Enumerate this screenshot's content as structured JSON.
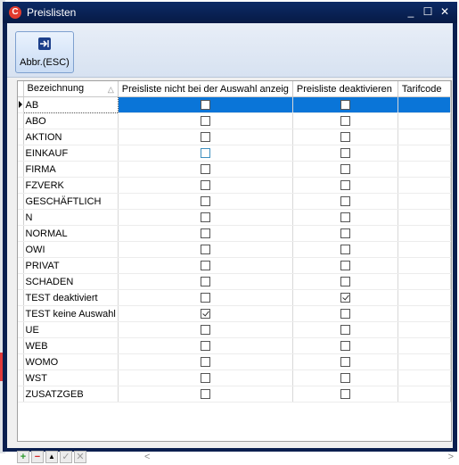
{
  "window": {
    "title": "Preislisten",
    "logo_letter": "C"
  },
  "window_buttons": {
    "minimize": "_",
    "maximize": "☐",
    "close": "✕"
  },
  "toolbar": {
    "close_label": "Abbr.(ESC)",
    "close_icon": "exit-arrow-icon"
  },
  "grid": {
    "columns": [
      "Bezeichnung",
      "Preisliste nicht bei der Auswahl anzeig",
      "Preisliste deaktivieren",
      "Tarifcode"
    ],
    "sort_indicator": "△",
    "selected_row": 0,
    "rows": [
      {
        "name": "AB",
        "hide": false,
        "deactivate": false,
        "tarif": ""
      },
      {
        "name": "ABO",
        "hide": false,
        "deactivate": false,
        "tarif": ""
      },
      {
        "name": "AKTION",
        "hide": false,
        "deactivate": false,
        "tarif": ""
      },
      {
        "name": "EINKAUF",
        "hide": false,
        "deactivate": false,
        "tarif": ""
      },
      {
        "name": "FIRMA",
        "hide": false,
        "deactivate": false,
        "tarif": ""
      },
      {
        "name": "FZVERK",
        "hide": false,
        "deactivate": false,
        "tarif": ""
      },
      {
        "name": "GESCHÄFTLICH",
        "hide": false,
        "deactivate": false,
        "tarif": ""
      },
      {
        "name": "N",
        "hide": false,
        "deactivate": false,
        "tarif": ""
      },
      {
        "name": "NORMAL",
        "hide": false,
        "deactivate": false,
        "tarif": ""
      },
      {
        "name": "OWI",
        "hide": false,
        "deactivate": false,
        "tarif": ""
      },
      {
        "name": "PRIVAT",
        "hide": false,
        "deactivate": false,
        "tarif": ""
      },
      {
        "name": "SCHADEN",
        "hide": false,
        "deactivate": false,
        "tarif": ""
      },
      {
        "name": "TEST deaktiviert",
        "hide": false,
        "deactivate": true,
        "tarif": ""
      },
      {
        "name": "TEST keine Auswahl",
        "hide": true,
        "deactivate": false,
        "tarif": ""
      },
      {
        "name": "UE",
        "hide": false,
        "deactivate": false,
        "tarif": ""
      },
      {
        "name": "WEB",
        "hide": false,
        "deactivate": false,
        "tarif": ""
      },
      {
        "name": "WOMO",
        "hide": false,
        "deactivate": false,
        "tarif": ""
      },
      {
        "name": "WST",
        "hide": false,
        "deactivate": false,
        "tarif": ""
      },
      {
        "name": "ZUSATZGEB",
        "hide": false,
        "deactivate": false,
        "tarif": ""
      }
    ]
  },
  "navigator": {
    "add": "+",
    "delete": "−",
    "up": "▲",
    "post": "✓",
    "cancel": "✕",
    "scroll_left": "<",
    "scroll_right": ">"
  },
  "colors": {
    "selection": "#0a75d8",
    "title_bar": "#0c2a66",
    "add": "#2e9a2e",
    "delete": "#d22828"
  }
}
